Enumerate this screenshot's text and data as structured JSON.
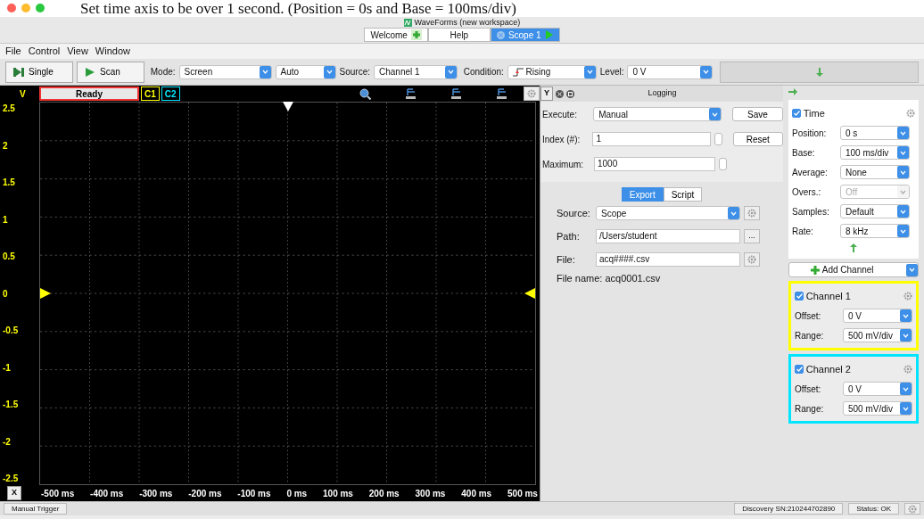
{
  "caption": "Set time axis to be over 1 second. (Position = 0s and Base = 100ms/div)",
  "window": {
    "title": "WaveForms  (new workspace)"
  },
  "tabs": [
    {
      "label": "Welcome",
      "selected": false,
      "kind": "add"
    },
    {
      "label": "Help",
      "selected": false,
      "kind": "plain"
    },
    {
      "label": "Scope 1",
      "selected": true,
      "kind": "run"
    }
  ],
  "menu": [
    "File",
    "Control",
    "View",
    "Window"
  ],
  "toolbar": {
    "single": "Single",
    "scan": "Scan",
    "mode_label": "Mode:",
    "mode": "Screen",
    "auto": "Auto",
    "source_label": "Source:",
    "source": "Channel 1",
    "condition_label": "Condition:",
    "condition": "Rising",
    "level_label": "Level:",
    "level": "0 V"
  },
  "scope": {
    "status": "Ready",
    "channels": [
      {
        "label": "C1",
        "color": "#ffff00"
      },
      {
        "label": "C2",
        "color": "#00e5ff"
      }
    ],
    "y_unit": "V",
    "y_labels": [
      "2.5",
      "2",
      "1.5",
      "1",
      "0.5",
      "0",
      "-0.5",
      "-1",
      "-1.5",
      "-2",
      "-2.5"
    ],
    "x_button": "X",
    "x_labels": [
      "-500 ms",
      "-400 ms",
      "-300 ms",
      "-200 ms",
      "-100 ms",
      "0 ms",
      "100 ms",
      "200 ms",
      "300 ms",
      "400 ms",
      "500 ms"
    ]
  },
  "logging": {
    "y_button": "Y",
    "title": "Logging",
    "execute_label": "Execute:",
    "execute": "Manual",
    "save": "Save",
    "index_label": "Index (#):",
    "index": "1",
    "reset": "Reset",
    "maximum_label": "Maximum:",
    "maximum": "1000",
    "subtabs": [
      {
        "label": "Export",
        "selected": true
      },
      {
        "label": "Script",
        "selected": false
      }
    ],
    "source_label": "Source:",
    "source": "Scope",
    "path_label": "Path:",
    "path": "/Users/student",
    "browse": "...",
    "file_label": "File:",
    "file": "acq####.csv",
    "file_name": "File name: acq0001.csv"
  },
  "time": {
    "label": "Time",
    "checked": true,
    "rows": [
      {
        "label": "Position:",
        "value": "0 s",
        "disabled": false
      },
      {
        "label": "Base:",
        "value": "100 ms/div",
        "disabled": false
      },
      {
        "label": "Average:",
        "value": "None",
        "disabled": false
      },
      {
        "label": "Overs.:",
        "value": "Off",
        "disabled": true
      },
      {
        "label": "Samples:",
        "value": "Default",
        "disabled": false
      },
      {
        "label": "Rate:",
        "value": "8 kHz",
        "disabled": false
      }
    ]
  },
  "add_channel": "Add Channel",
  "channels": [
    {
      "label": "Channel 1",
      "checked": true,
      "color": "#ffff00",
      "rows": [
        {
          "label": "Offset:",
          "value": "0 V"
        },
        {
          "label": "Range:",
          "value": "500 mV/div"
        }
      ]
    },
    {
      "label": "Channel 2",
      "checked": true,
      "color": "#00e5ff",
      "rows": [
        {
          "label": "Offset:",
          "value": "0 V"
        },
        {
          "label": "Range:",
          "value": "500 mV/div"
        }
      ]
    }
  ],
  "status_bar": {
    "trigger": "Manual Trigger",
    "device": "Discovery SN:210244702890",
    "status": "Status: OK"
  }
}
